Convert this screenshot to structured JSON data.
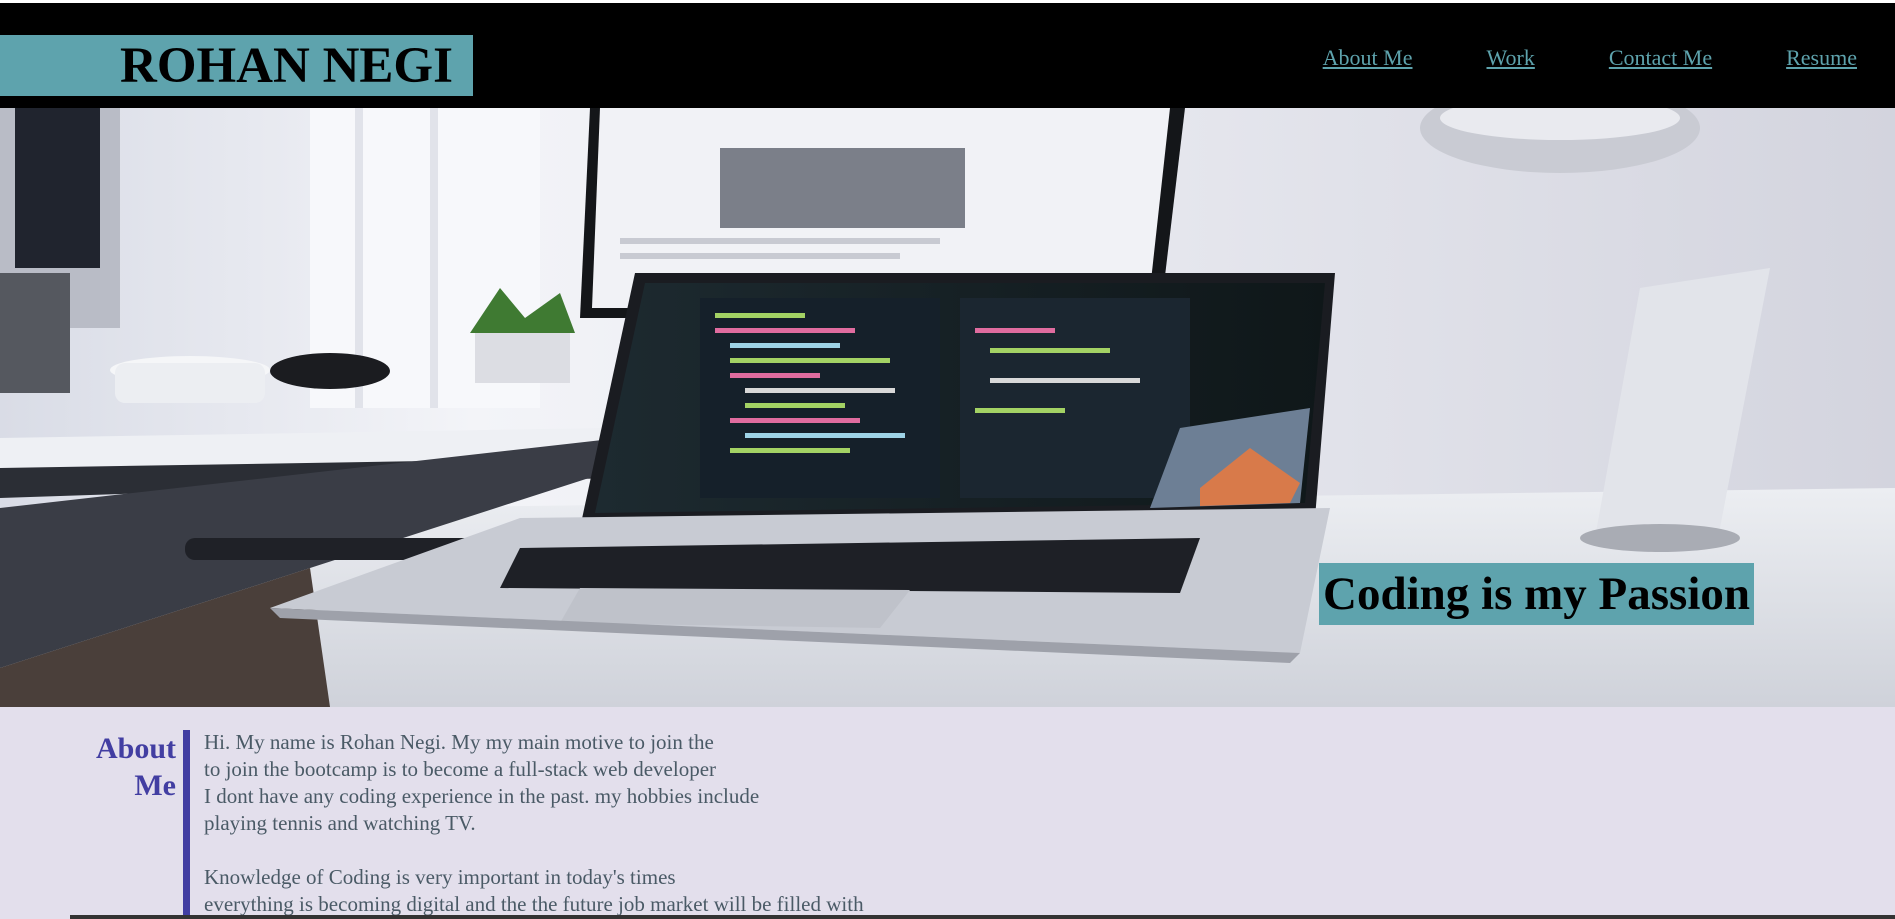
{
  "header": {
    "name": "ROHAN NEGI",
    "nav": [
      {
        "label": "About Me"
      },
      {
        "label": "Work"
      },
      {
        "label": "Contact Me"
      },
      {
        "label": "Resume"
      }
    ]
  },
  "hero": {
    "tagline": "Coding is my Passion"
  },
  "about": {
    "title_line1": "About",
    "title_line2": "Me",
    "paragraph1": [
      "Hi. My name is Rohan Negi. My my main motive to join the",
      "to join the bootcamp is to become a full-stack web developer",
      "I dont have any coding experience in the past. my hobbies include",
      "playing tennis and watching TV."
    ],
    "paragraph2": [
      "Knowledge of Coding is very important in today's times",
      "everything is becoming digital and the the future job market will be filled with"
    ]
  },
  "colors": {
    "accent": "#5ea3ad",
    "about_bg": "#e3dfec",
    "about_title": "#423ea2"
  }
}
